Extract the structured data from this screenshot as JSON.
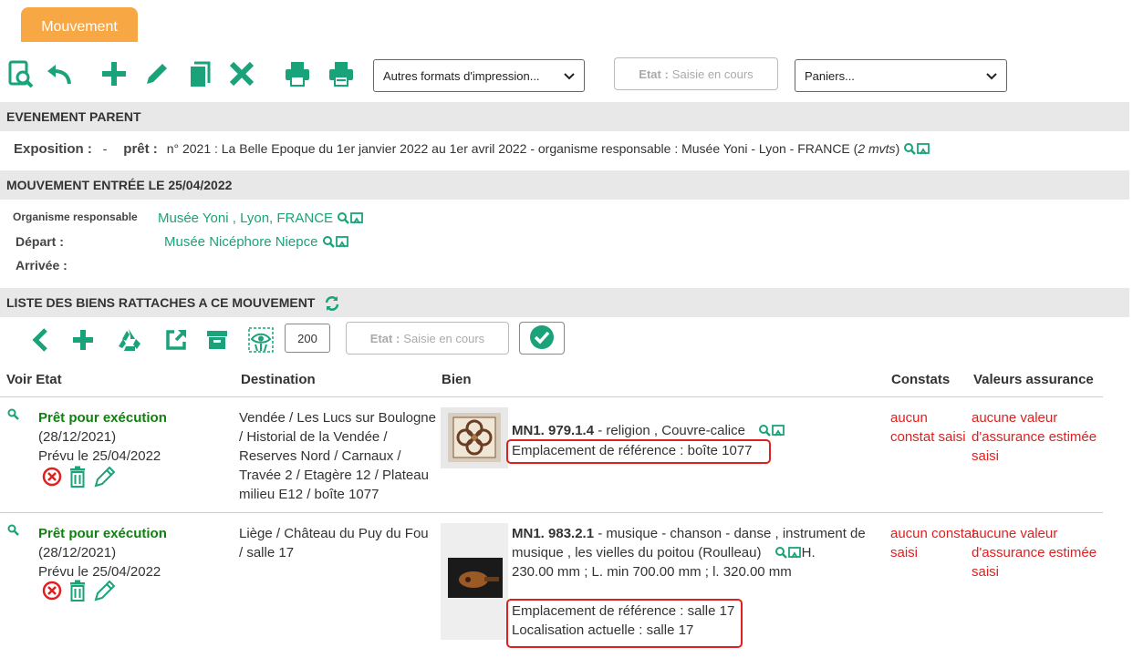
{
  "tab": {
    "label": "Mouvement"
  },
  "toolbar": {
    "print_formats": "Autres formats d'impression...",
    "etat_label": "Etat :",
    "etat_value": "Saisie en cours",
    "paniers": "Paniers..."
  },
  "parent": {
    "header": "EVENEMENT PARENT",
    "exposition_label": "Exposition :",
    "exposition_value": "-",
    "pret_label": "prêt :",
    "pret_value": "n° 2021 : La Belle Epoque du 1er janvier 2022 au 1er avril 2022 - organisme responsable : Musée Yoni - Lyon - FRANCE (",
    "pret_count": "2 mvts",
    "pret_close": ")"
  },
  "mouvement": {
    "header": "MOUVEMENT ENTRÉE LE 25/04/2022",
    "organisme_label": "Organisme responsable",
    "organisme_value": "Musée Yoni , Lyon, FRANCE",
    "depart_label": "Départ :",
    "depart_value": "Musée Nicéphore Niepce",
    "arrivee_label": "Arrivée :"
  },
  "liste": {
    "header": "LISTE DES BIENS RATTACHES A CE MOUVEMENT",
    "count": "200",
    "etat_label": "Etat :",
    "etat_value": "Saisie en cours"
  },
  "columns": {
    "voir_etat": "Voir Etat",
    "destination": "Destination",
    "bien": "Bien",
    "constats": "Constats",
    "valeurs": "Valeurs assurance"
  },
  "rows": [
    {
      "status": "Prêt pour exécution",
      "date": "(28/12/2021)",
      "prevu": "Prévu le 25/04/2022",
      "destination": "Vendée / Les Lucs sur Boulogne / Historial de la Vendée / Reserves Nord / Carnaux / Travée 2 / Etagère 12 / Plateau milieu E12 / boîte 1077",
      "bien_id": "MN1. 979.1.4",
      "bien_desc": " - religion , Couvre-calice",
      "emplacement": "Emplacement de référence : boîte 1077",
      "constat": "aucun constat saisi",
      "valeur": "aucune valeur d'assurance estimée saisi"
    },
    {
      "status": "Prêt pour exécution",
      "date": "(28/12/2021)",
      "prevu": "Prévu le 25/04/2022",
      "destination": "Liège / Château du Puy du Fou / salle 17",
      "bien_id": "MN1. 983.2.1",
      "bien_desc": " - musique - chanson - danse , instrument de musique , les vielles du poitou (Roulleau)",
      "bien_dim_a": "H.",
      "bien_dim_b": "230.00 mm ; L. min 700.00 mm ; l. 320.00 mm",
      "emplacement": "Emplacement de référence : salle 17",
      "localisation": "Localisation actuelle : salle 17",
      "constat": "aucun constat saisi",
      "valeur": "aucune valeur d'assurance estimée saisi"
    }
  ],
  "colors": {
    "accent": "#1aa37a",
    "tab": "#f7a743",
    "status": "#108010",
    "alert": "#e02020"
  }
}
